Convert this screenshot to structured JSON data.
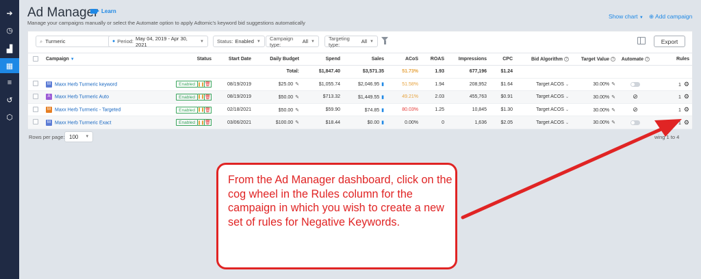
{
  "sidebar": {
    "items": [
      {
        "icon": "arrow-right-icon",
        "glyph": "➔"
      },
      {
        "icon": "clock-icon",
        "glyph": "◷"
      },
      {
        "icon": "chart-icon",
        "glyph": "▟"
      },
      {
        "icon": "grid-icon",
        "glyph": "▦"
      },
      {
        "icon": "list-icon",
        "glyph": "≡"
      },
      {
        "icon": "history-icon",
        "glyph": "↺"
      },
      {
        "icon": "box-icon",
        "glyph": "⬡"
      }
    ]
  },
  "header": {
    "title": "Ad Manager",
    "learn_label": "Learn",
    "subtitle": "Manage your campaigns manually or select the Automate option to apply Adtomic's keyword bid suggestions automatically",
    "show_chart_label": "Show chart",
    "add_campaign_label": "Add campaign"
  },
  "filters": {
    "search_value": "Turmeric",
    "period_label": "Period:",
    "period_value": "May 04, 2019 - Apr 30, 2021",
    "status_label": "Status:",
    "status_value": "Enabled",
    "campaign_type_label": "Campaign type:",
    "campaign_type_value": "All",
    "targeting_type_label": "Targeting type:",
    "targeting_type_value": "All",
    "export_label": "Export"
  },
  "table": {
    "headers": {
      "campaign": "Campaign",
      "status": "Status",
      "start_date": "Start Date",
      "daily_budget": "Daily Budget",
      "spend": "Spend",
      "sales": "Sales",
      "acos": "ACoS",
      "roas": "ROAS",
      "impressions": "Impressions",
      "cpc": "CPC",
      "bid_algorithm": "Bid Algorithm",
      "target_value": "Target Value",
      "automate": "Automate",
      "rules": "Rules"
    },
    "totals": {
      "label": "Total:",
      "spend": "$1,847.40",
      "sales": "$3,571.35",
      "acos": "51.73%",
      "roas": "1.93",
      "impressions": "677,196",
      "cpc": "$1.24"
    },
    "rows": [
      {
        "type": "M",
        "type_color": "#5b7bd5",
        "name": "Maxx Herb Turmeric keyword",
        "status": "Enabled",
        "start_date": "08/19/2019",
        "daily_budget": "$25.00",
        "spend": "$1,055.74",
        "sales": "$2,046.95",
        "acos": "51.58%",
        "acos_color": "#e6a23c",
        "roas": "1.94",
        "impressions": "208,952",
        "cpc": "$1.64",
        "bid_algorithm": "Target ACOS",
        "target_value": "30.00%",
        "automate": "toggle",
        "rules": "1"
      },
      {
        "type": "A",
        "type_color": "#9c5bd5",
        "name": "Maxx Herb Turmeric Auto",
        "status": "Enabled",
        "start_date": "08/19/2019",
        "daily_budget": "$50.00",
        "spend": "$713.32",
        "sales": "$1,449.55",
        "acos": "49.21%",
        "acos_color": "#e6a23c",
        "roas": "2.03",
        "impressions": "455,763",
        "cpc": "$0.91",
        "bid_algorithm": "Target ACOS",
        "target_value": "30.00%",
        "automate": "ban",
        "rules": "1"
      },
      {
        "type": "M",
        "type_color": "#e67e22",
        "name": "Maxx Herb Turmeric - Targeted",
        "status": "Enabled",
        "start_date": "02/18/2021",
        "daily_budget": "$50.00",
        "spend": "$59.90",
        "sales": "$74.85",
        "acos": "80.03%",
        "acos_color": "#e53935",
        "roas": "1.25",
        "impressions": "10,845",
        "cpc": "$1.30",
        "bid_algorithm": "Target ACOS",
        "target_value": "30.00%",
        "automate": "ban",
        "rules": "1"
      },
      {
        "type": "M",
        "type_color": "#5b7bd5",
        "name": "Maxx Herb Turmeric Exact",
        "status": "Enabled",
        "start_date": "03/06/2021",
        "daily_budget": "$100.00",
        "spend": "$18.44",
        "sales": "$0.00",
        "acos": "0.00%",
        "acos_color": "#333333",
        "roas": "0",
        "impressions": "1,636",
        "cpc": "$2.05",
        "bid_algorithm": "Target ACOS",
        "target_value": "30.00%",
        "automate": "toggle",
        "rules": "1"
      }
    ]
  },
  "footer": {
    "rows_per_page_label": "Rows per page:",
    "rows_per_page_value": "100",
    "showing_text": "wing 1 to 4"
  },
  "callout": {
    "text": "From the Ad Manager dashboard, click on the cog wheel in the Rules column for the campaign in which you wish to create a new set of rules for Negative Keywords.",
    "color": "#e02424"
  },
  "colors": {
    "sidebar": "#1f2a44",
    "accent": "#1e88e5",
    "enabled": "#3aa55d",
    "callout": "#e02424"
  }
}
